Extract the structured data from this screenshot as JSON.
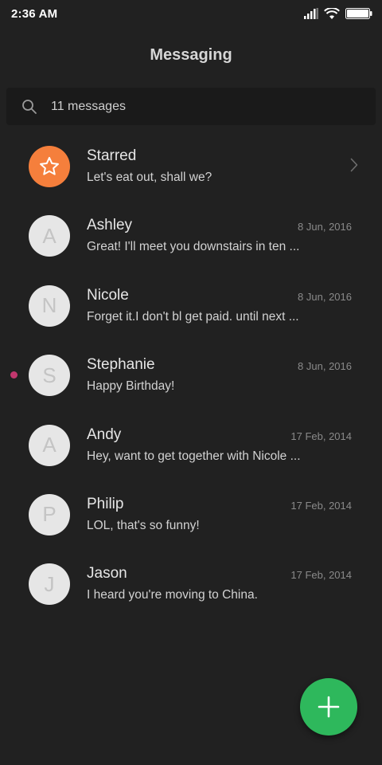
{
  "status_bar": {
    "time": "2:36 AM"
  },
  "header": {
    "title": "Messaging"
  },
  "search": {
    "text": "11 messages"
  },
  "conversations": [
    {
      "name": "Starred",
      "preview": "Let's eat out, shall we?",
      "date": "",
      "initial": "",
      "type": "starred",
      "unread": false
    },
    {
      "name": "Ashley",
      "preview": "Great! I'll meet you downstairs in ten ...",
      "date": "8 Jun, 2016",
      "initial": "A",
      "unread": false
    },
    {
      "name": "Nicole",
      "preview": "Forget it.I don't bl get paid. until next ...",
      "date": "8 Jun, 2016",
      "initial": "N",
      "unread": false
    },
    {
      "name": "Stephanie",
      "preview": "Happy Birthday!",
      "date": "8 Jun, 2016",
      "initial": "S",
      "unread": true
    },
    {
      "name": "Andy",
      "preview": "Hey, want to get together with Nicole ...",
      "date": "17 Feb, 2014",
      "initial": "A",
      "unread": false
    },
    {
      "name": "Philip",
      "preview": "LOL, that's so funny!",
      "date": "17 Feb, 2014",
      "initial": "P",
      "unread": false
    },
    {
      "name": "Jason",
      "preview": "I heard you're moving to China.",
      "date": "17 Feb, 2014",
      "initial": "J",
      "unread": false
    }
  ],
  "colors": {
    "background": "#212121",
    "starred_avatar": "#f57f3c",
    "unread_dot": "#c2376e",
    "fab": "#2eb85c"
  },
  "icons": {
    "search": "search-icon",
    "star": "star-icon",
    "chevron": "chevron-right-icon",
    "fab": "plus-icon"
  }
}
